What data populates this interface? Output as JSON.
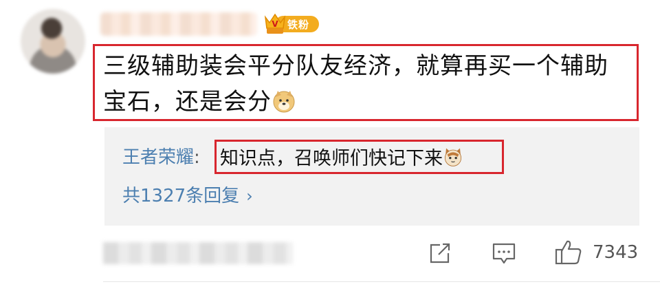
{
  "comment": {
    "fan_badge_label": "铁粉",
    "text_line1": "三级辅助装会平分队友经济，就算再买一个辅助",
    "text_line2": "宝石，还是会分",
    "emoji_icon": "doge-emoji"
  },
  "reply": {
    "author": "王者荣耀",
    "separator": ":",
    "text": "知识点，召唤师们快记下来",
    "emoji_icon": "cat-emoji",
    "count_label": "共1327条回复",
    "chevron": "›"
  },
  "actions": {
    "share_icon": "share-icon",
    "comment_icon": "comment-icon",
    "like_icon": "thumbs-up-icon",
    "like_count": "7343"
  },
  "colors": {
    "highlight_border": "#d8262e",
    "link_blue": "#4c7fb0",
    "badge_orange": "#f3ac1f"
  }
}
